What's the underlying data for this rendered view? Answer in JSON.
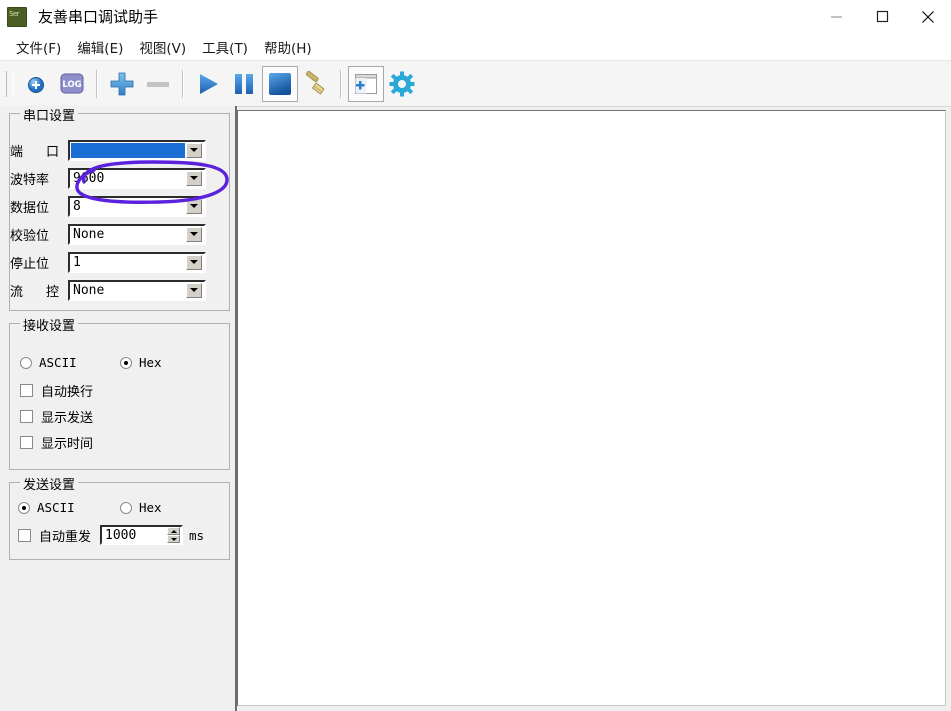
{
  "window": {
    "title": "友善串口调试助手",
    "icon": "serial-app-icon",
    "controls": {
      "minimize": "minimize-icon",
      "maximize": "maximize-icon",
      "close": "close-icon"
    }
  },
  "menubar": {
    "items": [
      {
        "label": "文件(F)",
        "name": "menu-file"
      },
      {
        "label": "编辑(E)",
        "name": "menu-edit"
      },
      {
        "label": "视图(V)",
        "name": "menu-view"
      },
      {
        "label": "工具(T)",
        "name": "menu-tools"
      },
      {
        "label": "帮助(H)",
        "name": "menu-help"
      }
    ]
  },
  "toolbar": {
    "buttons": [
      {
        "name": "add-connection-icon",
        "icon": "blue-circle-plus",
        "enabled": true
      },
      {
        "name": "log-icon",
        "icon": "log-badge",
        "label": "LOG",
        "enabled": true
      },
      {
        "name": "add-icon",
        "icon": "plus-sign",
        "enabled": true
      },
      {
        "name": "remove-icon",
        "icon": "minus-sign",
        "enabled": false
      },
      {
        "name": "play-icon",
        "icon": "triangle-right",
        "enabled": true
      },
      {
        "name": "pause-icon",
        "icon": "double-bar",
        "enabled": true
      },
      {
        "name": "stop-icon",
        "icon": "filled-square",
        "enabled": true,
        "pressed": false
      },
      {
        "name": "clear-icon",
        "icon": "broom",
        "enabled": true
      },
      {
        "name": "new-window-icon",
        "icon": "window-plus",
        "enabled": true,
        "pressed": true
      },
      {
        "name": "settings-icon",
        "icon": "gear",
        "enabled": true
      }
    ]
  },
  "serial_settings": {
    "legend": "串口设置",
    "fields": [
      {
        "label": "端 口",
        "name": "port",
        "value": "",
        "selected": true
      },
      {
        "label": "波特率",
        "name": "baud-rate",
        "value": "9600",
        "selected": false
      },
      {
        "label": "数据位",
        "name": "data-bits",
        "value": "8",
        "selected": false
      },
      {
        "label": "校验位",
        "name": "parity",
        "value": "None",
        "selected": false
      },
      {
        "label": "停止位",
        "name": "stop-bits",
        "value": "1",
        "selected": false
      },
      {
        "label": "流 控",
        "name": "flow-control",
        "value": "None",
        "selected": false
      }
    ]
  },
  "receive_settings": {
    "legend": "接收设置",
    "format": {
      "ascii": {
        "label": "ASCII",
        "checked": false
      },
      "hex": {
        "label": "Hex",
        "checked": true
      }
    },
    "options": [
      {
        "label": "自动换行",
        "name": "auto-wrap",
        "checked": false
      },
      {
        "label": "显示发送",
        "name": "show-send",
        "checked": false
      },
      {
        "label": "显示时间",
        "name": "show-time",
        "checked": false
      }
    ]
  },
  "send_settings": {
    "legend": "发送设置",
    "format": {
      "ascii": {
        "label": "ASCII",
        "checked": true
      },
      "hex": {
        "label": "Hex",
        "checked": false
      }
    },
    "auto_resend": {
      "label": "自动重发",
      "checked": false,
      "interval": "1000",
      "unit": "ms"
    }
  },
  "annotation": {
    "shape": "hand-drawn-ellipse",
    "color": "#5a22dd",
    "target": "baud-rate"
  },
  "main_area": {
    "content": ""
  }
}
